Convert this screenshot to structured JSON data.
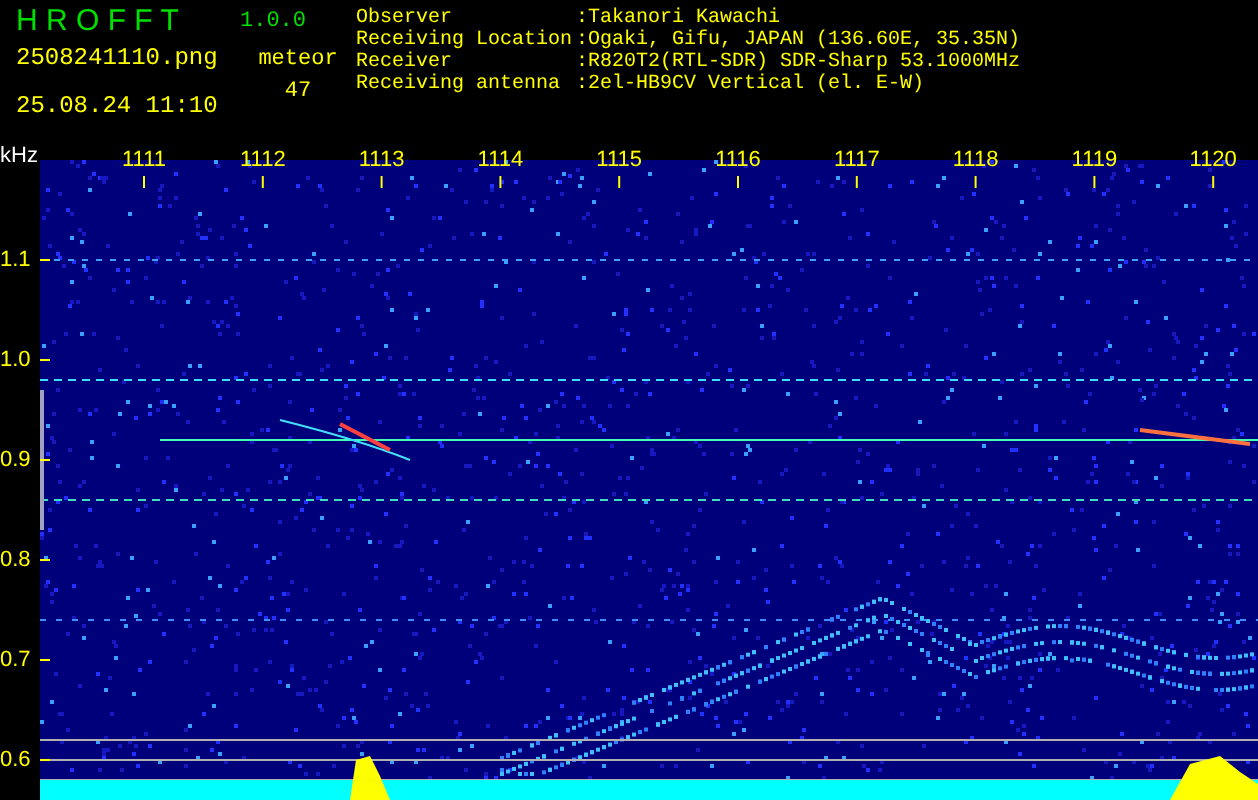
{
  "app": {
    "title": "H R O F F T",
    "version": "1.0.0"
  },
  "file": {
    "name": "2508241110.png",
    "timestamp": "25.08.24 11:10"
  },
  "meteor": {
    "label": "meteor",
    "count": "47"
  },
  "info": [
    {
      "label": "Observer",
      "separator": ":",
      "value": "Takanori Kawachi"
    },
    {
      "label": "Receiving Location",
      "separator": ":",
      "value": "Ogaki, Gifu, JAPAN (136.60E, 35.35N)"
    },
    {
      "label": "Receiver",
      "separator": ":",
      "value": "R820T2(RTL-SDR) SDR-Sharp 53.1000MHz"
    },
    {
      "label": "Receiving antenna",
      "separator": ":",
      "value": "2el-HB9CV Vertical (el. E-W)"
    }
  ],
  "spectrogram": {
    "unit": "kHz",
    "time_labels": [
      "1111",
      "1112",
      "1113",
      "1114",
      "1115",
      "1116",
      "1117",
      "1118",
      "1119",
      "1120"
    ],
    "frequency_labels": [
      "1.1",
      "1.0",
      "0.9",
      "0.8",
      "0.7",
      "0.6"
    ]
  }
}
